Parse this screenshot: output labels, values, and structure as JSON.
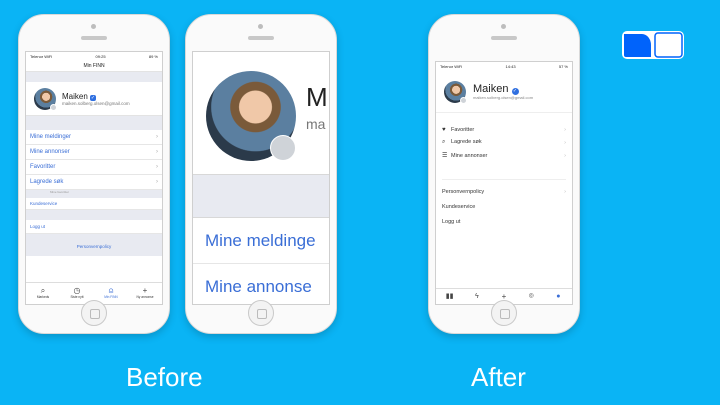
{
  "captions": {
    "before": "Before",
    "after": "After"
  },
  "colors": {
    "background": "#0ab4f5",
    "link_blue": "#3a6ed6",
    "verified_blue": "#2f6fe0",
    "logo_blue": "#0063fb"
  },
  "before_phone": {
    "status": {
      "carrier": "Telenor WiFi",
      "time": "09:25",
      "battery": "89 %"
    },
    "title": "Min FINN",
    "profile": {
      "name": "Maiken",
      "email": "maiken.solberg.olsen@gmail.com"
    },
    "menu_items": [
      {
        "label": "Mine meldinger"
      },
      {
        "label": "Mine annonser"
      },
      {
        "label": "Favoritter"
      },
      {
        "label": "Lagrede søk"
      }
    ],
    "section_label": "Mine favoritter",
    "help_item": "Kundeservice",
    "logout": "Logg ut",
    "policy_link": "Personvernpolicy",
    "tabs": [
      {
        "icon": "search-icon",
        "label": "Markeds"
      },
      {
        "icon": "clock-icon",
        "label": "Siste nytt"
      },
      {
        "icon": "user-icon",
        "label": "Min FINN"
      },
      {
        "icon": "plus-icon",
        "label": "Ny annonse"
      }
    ]
  },
  "zoom_phone": {
    "name_initial": "M",
    "email_fragment": "ma",
    "menu_items": [
      {
        "label": "Mine meldinge"
      },
      {
        "label": "Mine annonse"
      }
    ]
  },
  "after_phone": {
    "status": {
      "carrier": "Telenor WiFi",
      "time": "14:43",
      "battery": "57 %"
    },
    "profile": {
      "name": "Maiken",
      "email": "maiken.solberg.olsen@gmail.com"
    },
    "menu_items": [
      {
        "icon": "heart-icon",
        "label": "Favoritter"
      },
      {
        "icon": "search-icon",
        "label": "Lagrede søk"
      },
      {
        "icon": "list-icon",
        "label": "Mine annonser"
      }
    ],
    "secondary_items": [
      {
        "label": "Personvernpolicy"
      },
      {
        "label": "Kundeservice"
      },
      {
        "label": "Logg ut"
      }
    ],
    "tabs": [
      {
        "icon": "grid-icon"
      },
      {
        "icon": "bolt-icon"
      },
      {
        "icon": "plus-icon"
      },
      {
        "icon": "chat-icon"
      },
      {
        "icon": "user-icon"
      }
    ]
  }
}
